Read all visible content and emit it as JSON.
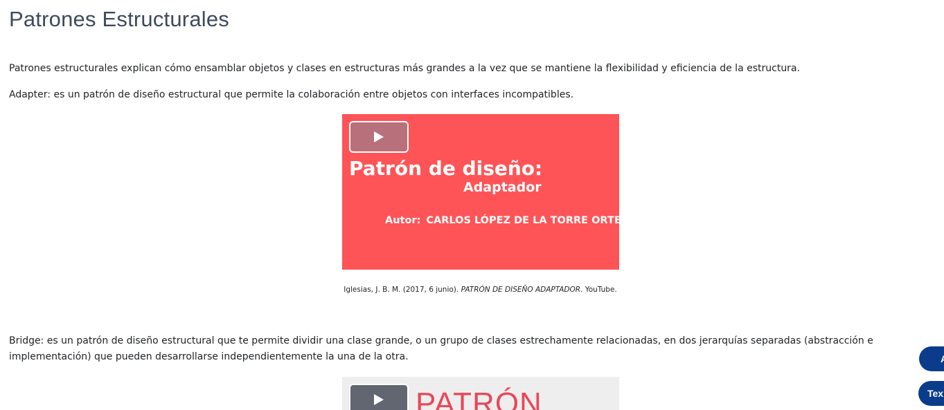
{
  "page": {
    "title": "Patrones Estructurales"
  },
  "content": {
    "intro": "Patrones estructurales explican cómo ensamblar objetos y clases en estructuras más grandes a la vez que se mantiene la flexibilidad y eficiencia de la estructura.",
    "adapter": "Adapter: es un patrón de diseño estructural que permite la colaboración entre objetos con interfaces incompatibles.",
    "bridge": "Bridge: es un patrón de diseño estructural que te permite dividir una clase grande, o un grupo de clases estrechamente relacionadas, en dos jerarquías separadas (abstracción e implementación) que pueden desarrollarse independientemente la una de la otra."
  },
  "video_adapter": {
    "play_icon": "play-icon",
    "title": "Patrón de diseño:",
    "subtitle": "Adaptador",
    "author_label": "Autor:",
    "author_name": "CARLOS LÓPEZ DE LA TORRE ORTEGO",
    "background_color": "#fe5457"
  },
  "caption_adapter": {
    "prefix": "Iglesias, J. B. M. (2017, 6 junio). ",
    "title": "PATRÓN DE DISEÑO ADAPTADOR",
    "suffix": ". YouTube."
  },
  "video_bridge": {
    "play_icon": "play-icon",
    "title": "PATRÓN",
    "title_color": "#e8475a"
  },
  "floating_buttons": {
    "first_label": "A",
    "second_label": "Tex",
    "color": "#0b3c8c"
  }
}
